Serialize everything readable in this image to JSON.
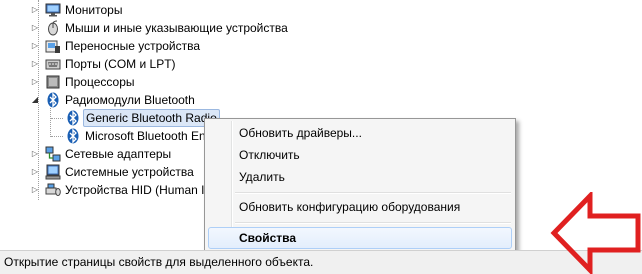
{
  "tree": {
    "items": [
      {
        "label": "Мониторы",
        "icon": "monitor-icon",
        "expander": "▷"
      },
      {
        "label": "Мыши и иные указывающие устройства",
        "icon": "mouse-icon",
        "expander": "▷"
      },
      {
        "label": "Переносные устройства",
        "icon": "portable-device-icon",
        "expander": "▷"
      },
      {
        "label": "Порты (COM и LPT)",
        "icon": "port-icon",
        "expander": "▷"
      },
      {
        "label": "Процессоры",
        "icon": "processor-icon",
        "expander": "▷"
      },
      {
        "label": "Радиомодули Bluetooth",
        "icon": "bluetooth-icon",
        "expander": "◢"
      },
      {
        "label": "Generic Bluetooth Radio",
        "icon": "bluetooth-icon"
      },
      {
        "label": "Microsoft Bluetooth Enumerator",
        "icon": "bluetooth-icon"
      },
      {
        "label": "Сетевые адаптеры",
        "icon": "network-adapter-icon",
        "expander": "▷"
      },
      {
        "label": "Системные устройства",
        "icon": "system-device-icon",
        "expander": "▷"
      },
      {
        "label": "Устройства HID (Human Interface Devices)",
        "icon": "hid-device-icon",
        "expander": "▷"
      }
    ]
  },
  "context_menu": {
    "update_drivers": "Обновить драйверы...",
    "disable": "Отключить",
    "uninstall": "Удалить",
    "scan_hardware": "Обновить конфигурацию оборудования",
    "properties": "Свойства"
  },
  "status_bar": {
    "text": "Открытие страницы свойств для выделенного объекта."
  },
  "colors": {
    "annotation_arrow": "#e02020",
    "selection": "#dbe7f7",
    "bluetooth": "#1a5fb4"
  }
}
